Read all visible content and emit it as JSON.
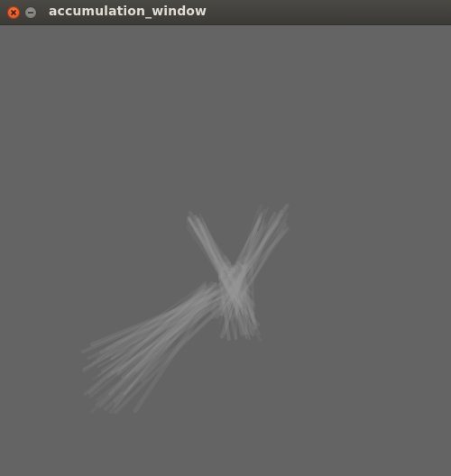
{
  "window": {
    "title": "accumulation_window"
  },
  "titlebar": {
    "close_icon": "close-icon",
    "minimize_icon": "minimize-icon"
  },
  "canvas": {
    "background_color": "#646464",
    "stroke_color": "#9a9a9a"
  }
}
